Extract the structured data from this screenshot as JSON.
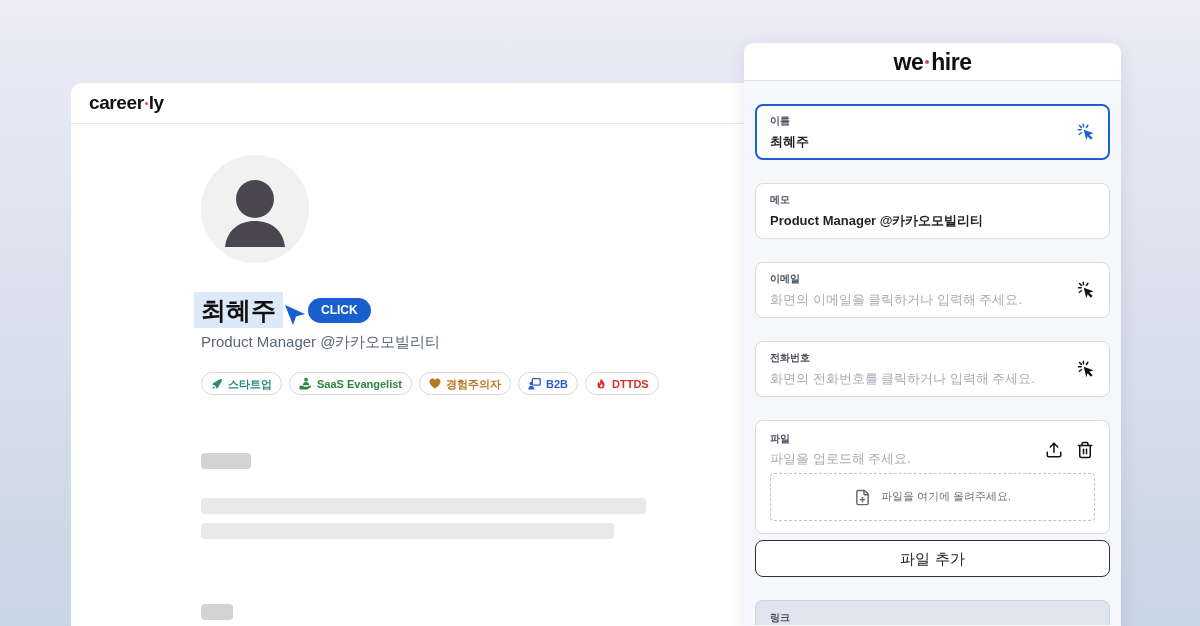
{
  "careerly_window": {
    "logo": {
      "left": "career",
      "right": "ly"
    },
    "profile": {
      "name": "최혜주",
      "name_highlighted": true,
      "click_badge": "CLICK",
      "subtitle": "Product Manager @카카오모빌리티",
      "tags": [
        {
          "label": "스타트업",
          "color": "#2d8a7b"
        },
        {
          "label": "SaaS Evangelist",
          "color": "#2e8540"
        },
        {
          "label": "경험주의자",
          "color": "#b87820"
        },
        {
          "label": "B2B",
          "color": "#2c5bd0"
        },
        {
          "label": "DTTDS",
          "color": "#d0312d"
        }
      ]
    }
  },
  "wehire_panel": {
    "logo": {
      "left": "we",
      "right": "hire"
    },
    "fields": [
      {
        "kind": "pick",
        "label": "이름",
        "value": "최혜주",
        "focused": true
      },
      {
        "kind": "text",
        "label": "메모",
        "value": "Product Manager @카카오모빌리티",
        "focused": false
      },
      {
        "kind": "pick",
        "label": "이메일",
        "placeholder": "화면의 이메일을 클릭하거나 입력해 주세요.",
        "focused": false
      },
      {
        "kind": "pick",
        "label": "전화번호",
        "placeholder": "화면의 전화번호를 클릭하거나 입력해 주세요.",
        "focused": false
      },
      {
        "kind": "file",
        "label": "파일",
        "placeholder": "파일을 업로드해 주세요.",
        "drop_hint": "파일을 여기에 올려주세요.",
        "focused": false
      }
    ],
    "add_file_button": "파일 추가",
    "link_section": {
      "label": "링크"
    }
  }
}
